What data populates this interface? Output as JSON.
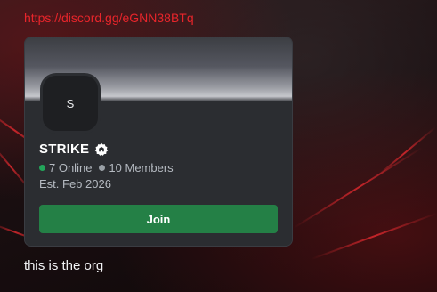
{
  "message": {
    "link_text": "https://discord.gg/eGNN38BTq",
    "body_text": "this is the org"
  },
  "invite_card": {
    "avatar_initial": "S",
    "server_name": "STRIKE",
    "online_count": "7 Online",
    "member_count": "10 Members",
    "established": "Est. Feb 2026",
    "join_label": "Join",
    "badge_icon": "server-badge-icon"
  },
  "colors": {
    "link": "#e8252b",
    "online_dot": "#23a55a",
    "members_dot": "#9aa0a6",
    "join_button": "#248046",
    "card_bg": "#2b2d31"
  }
}
